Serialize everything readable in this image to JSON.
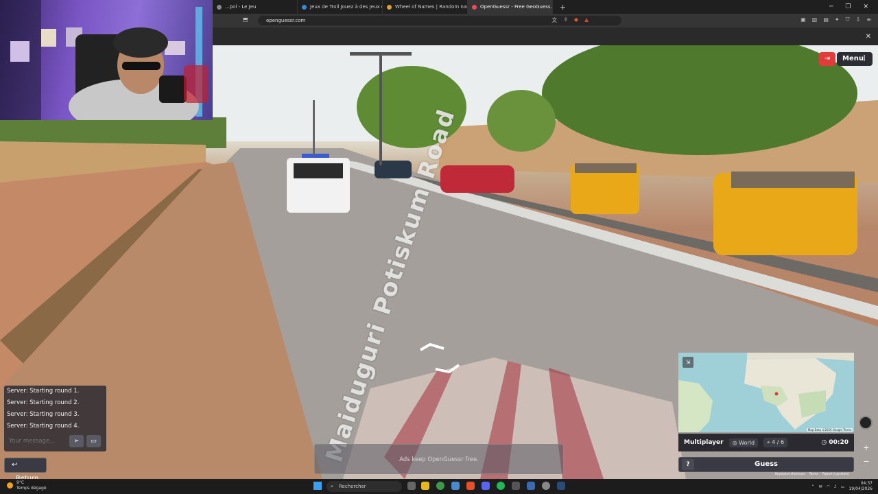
{
  "browser": {
    "tabs": [
      {
        "title": "...pol - Le Jeu",
        "active": false
      },
      {
        "title": "Jeux de Troll Jouez à des Jeux de Tr...",
        "active": false
      },
      {
        "title": "Wheel of Names | Random name pic...",
        "active": false
      },
      {
        "title": "OpenGuessr - Free GeoGuess...",
        "active": true
      }
    ],
    "new_tab": "+",
    "url": "openguessr.com"
  },
  "scene": {
    "street_name": "Maiduguri Potiskum Road"
  },
  "game": {
    "menu_label": "Menu",
    "chat": {
      "messages": [
        "Server: Starting round 1.",
        "Server: Starting round 2.",
        "Server: Starting round 3.",
        "Server: Starting round 4."
      ],
      "placeholder": "Your message..."
    },
    "return_label": "Return",
    "ad_text": "Ads keep OpenGuessr free.",
    "minimap": {
      "labels": [
        "North Atlantic Ocean",
        "Libya",
        "Egypt",
        "Algeria",
        "Mali",
        "Niger",
        "Chad",
        "Sudan",
        "Nigeria",
        "Ethiopia",
        "Kenya",
        "DRC",
        "Angola",
        "Brazil",
        "Peru",
        "Namibia",
        "South Atlantic Ocean"
      ],
      "attribution": "Map Data ©2026 Google  Terms"
    },
    "mode": "Multiplayer",
    "region": "World",
    "round": "4 / 6",
    "timer": "00:20",
    "guess_label": "Guess",
    "help_label": "?",
    "google_footer": [
      "Keyboard shortcuts",
      "Terms",
      "Report a problem"
    ]
  },
  "taskbar": {
    "temperature": "9°C",
    "weather": "Temps dégagé",
    "search_placeholder": "Rechercher",
    "time": "04:37",
    "date": "19/04/2026"
  },
  "colors": {
    "accent_red": "#e23b3b",
    "panel": "#2a2a30"
  }
}
